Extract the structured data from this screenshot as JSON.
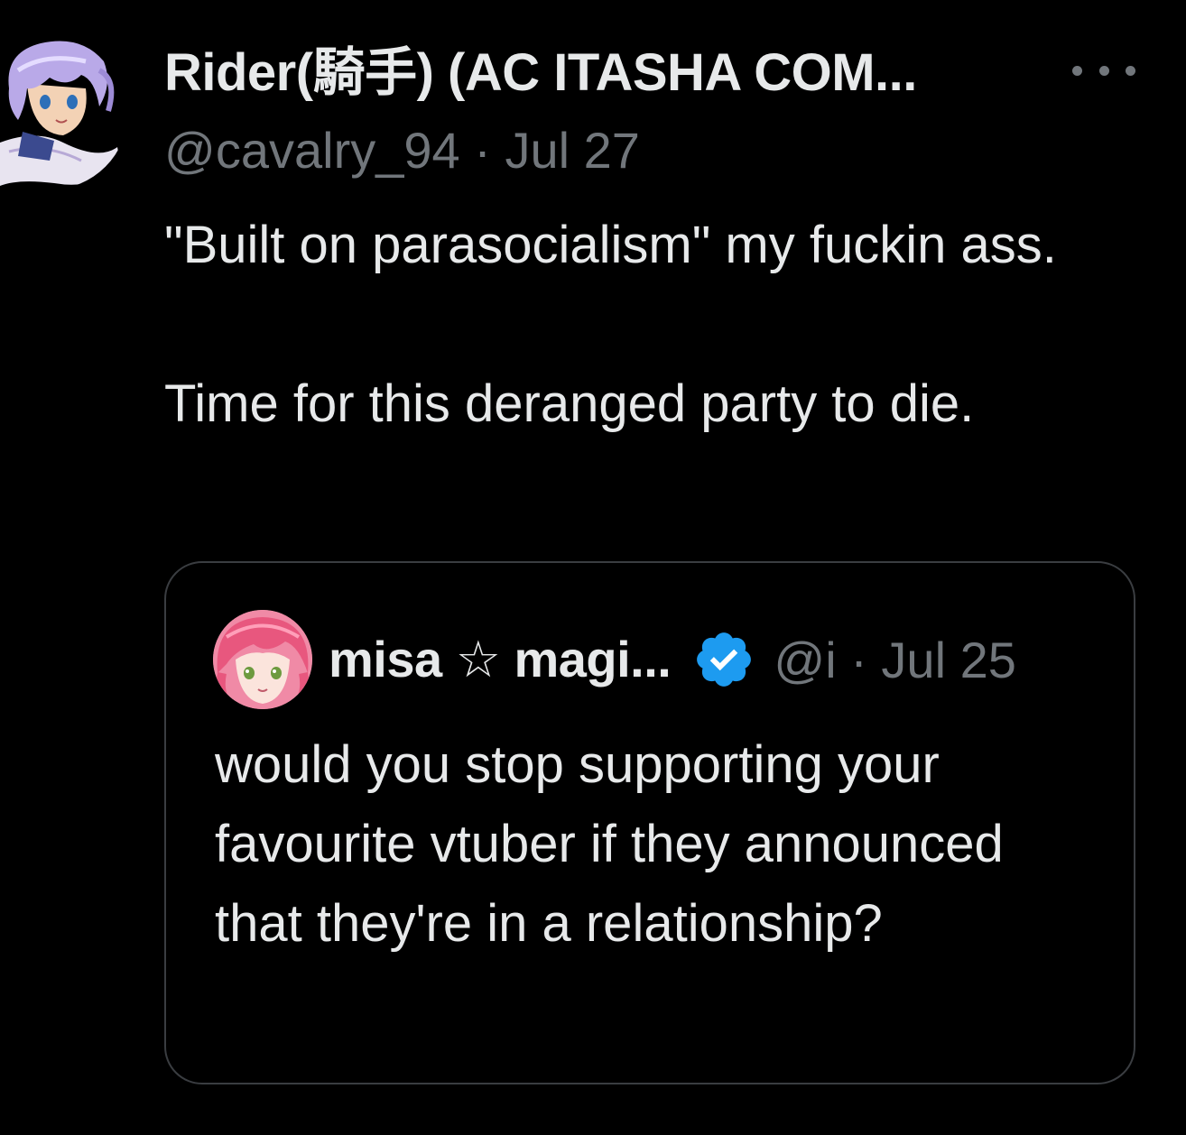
{
  "tweet": {
    "author": {
      "display_name": "Rider(騎手) (AC ITASHA COM...",
      "handle": "@cavalry_94",
      "avatar_icon": "anime-character-avatar"
    },
    "meta_separator": "·",
    "date": "Jul 27",
    "more_icon": "more-options-icon",
    "text": "\"Built on parasocialism\" my fuckin ass.\n\nTime for this deranged party to die.",
    "quoted_tweet": {
      "author": {
        "display_name": "misa ☆ magi...",
        "handle": "@i",
        "avatar_icon": "pink-haired-vtuber-avatar",
        "verified_icon": "verified-badge-icon"
      },
      "meta_separator": "·",
      "date": "Jul 25",
      "text": "would you stop supporting your favourite vtuber if they announced that they're in a relationship?"
    }
  },
  "colors": {
    "background": "#000000",
    "primary_text": "#e7e9ea",
    "secondary_text": "#71767b",
    "card_border": "#3a3d41",
    "verified_blue": "#1d9bf0"
  }
}
